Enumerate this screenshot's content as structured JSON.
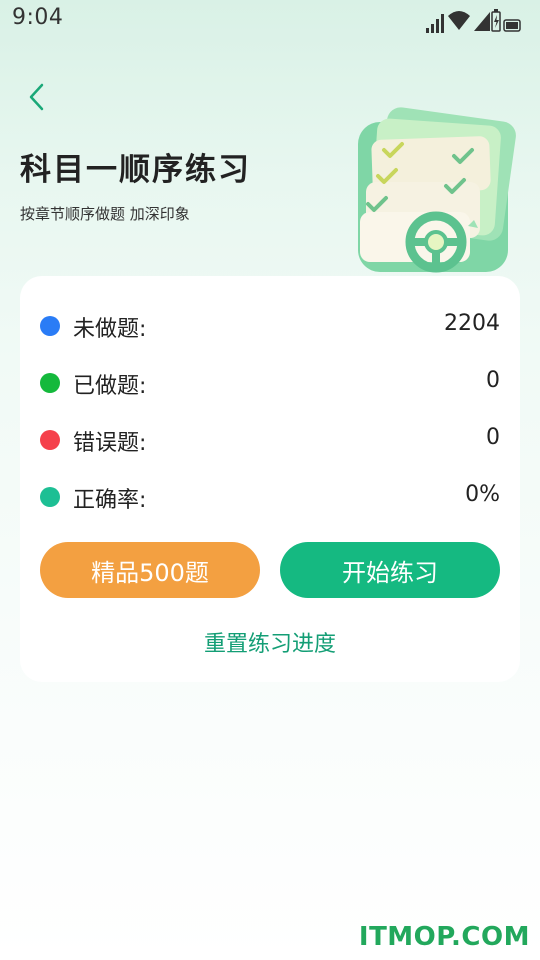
{
  "status_bar": {
    "time": "9:04"
  },
  "header": {
    "title": "科目一顺序练习",
    "subtitle": "按章节顺序做题 加深印象"
  },
  "colors": {
    "accent_green": "#15b981",
    "premium_orange": "#f3a041",
    "dot_blue": "#2a7cf6",
    "dot_green": "#14b93c",
    "dot_red": "#f5404b",
    "dot_teal": "#1dbf94"
  },
  "stats": [
    {
      "label": "未做题:",
      "value": "2204",
      "dot_color": "#2a7cf6"
    },
    {
      "label": "已做题:",
      "value": "0",
      "dot_color": "#14b93c"
    },
    {
      "label": "错误题:",
      "value": "0",
      "dot_color": "#f5404b"
    },
    {
      "label": "正确率:",
      "value": "0%",
      "dot_color": "#1dbf94"
    }
  ],
  "buttons": {
    "premium_label": "精品500题",
    "start_label": "开始练习",
    "reset_label": "重置练习进度"
  },
  "icons": {
    "back": "chevron-left-icon",
    "illustration": "checklist-steering-wheel-icon"
  },
  "watermark": "ITMOP.COM"
}
